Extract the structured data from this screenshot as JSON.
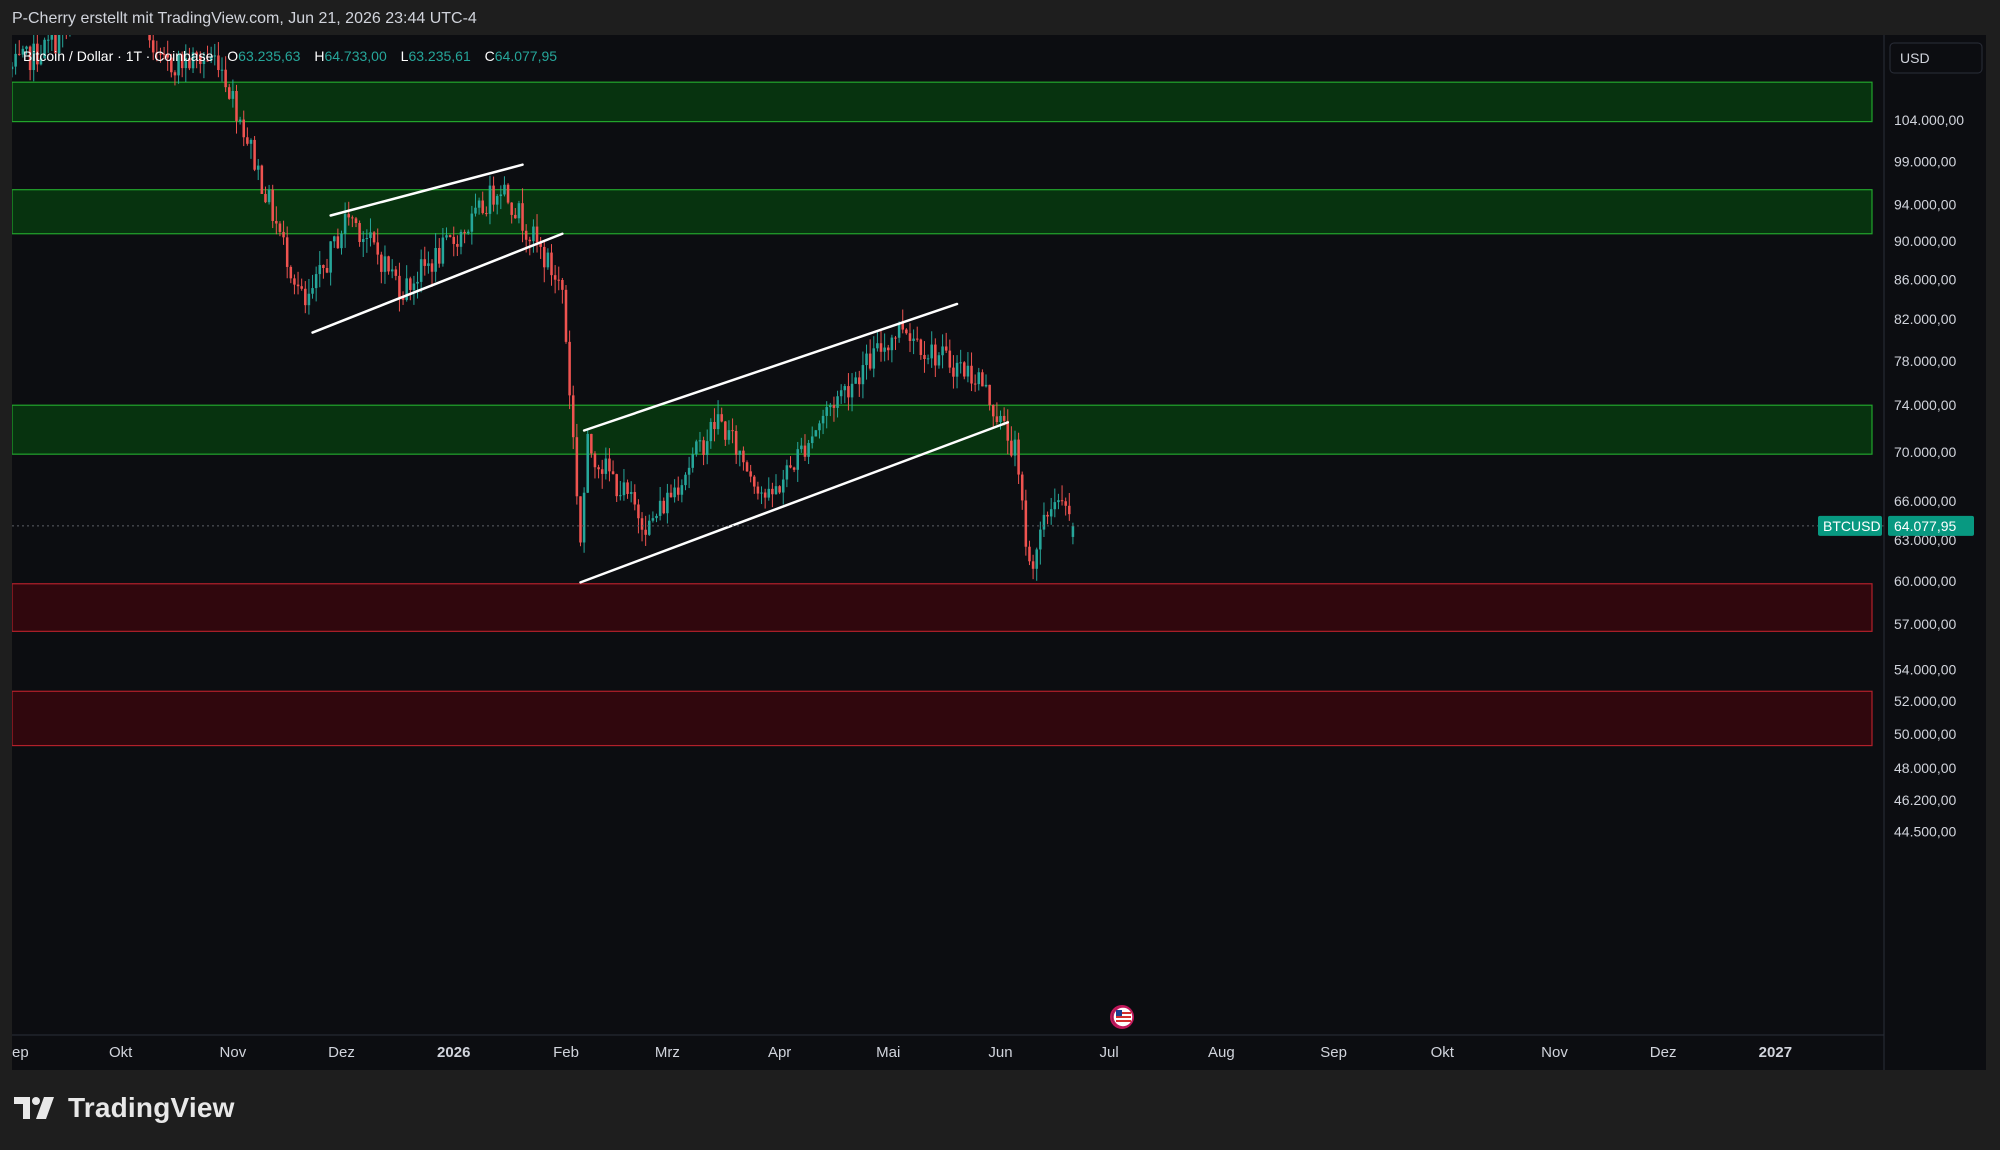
{
  "header": {
    "attribution": "P-Cherry erstellt mit TradingView.com, Jun 21, 2026 23:44 UTC-4"
  },
  "legend": {
    "symbol": "Bitcoin / Dollar · 1T · Coinbase",
    "open_label": "O",
    "open_value": "63.235,63",
    "high_label": "H",
    "high_value": "64.733,00",
    "low_label": "L",
    "low_value": "63.235,61",
    "close_label": "C",
    "close_value": "64.077,95"
  },
  "currency_label": "USD",
  "price_tag": {
    "symbol": "BTCUSD",
    "value": "64.077,95"
  },
  "footer": {
    "brand": "TradingView"
  },
  "colors": {
    "up": "#26a69a",
    "down": "#ef5350",
    "support_zone": "#07330f",
    "support_border": "#22a52c",
    "resistance_zone": "#30070d",
    "resistance_border": "#b3202a",
    "price_tag": "#089981"
  },
  "chart_data": {
    "type": "candlestick",
    "title": "Bitcoin / Dollar · 1T · Coinbase",
    "ylim": [
      44000,
      110000
    ],
    "y_scale": "log",
    "y_ticks": [
      {
        "value": 104000,
        "label": "104.000,00"
      },
      {
        "value": 99000,
        "label": "99.000,00"
      },
      {
        "value": 94000,
        "label": "94.000,00"
      },
      {
        "value": 90000,
        "label": "90.000,00"
      },
      {
        "value": 86000,
        "label": "86.000,00"
      },
      {
        "value": 82000,
        "label": "82.000,00"
      },
      {
        "value": 78000,
        "label": "78.000,00"
      },
      {
        "value": 74000,
        "label": "74.000,00"
      },
      {
        "value": 70000,
        "label": "70.000,00"
      },
      {
        "value": 66000,
        "label": "66.000,00"
      },
      {
        "value": 63000,
        "label": "63.000,00"
      },
      {
        "value": 60000,
        "label": "60.000,00"
      },
      {
        "value": 57000,
        "label": "57.000,00"
      },
      {
        "value": 54000,
        "label": "54.000,00"
      },
      {
        "value": 52000,
        "label": "52.000,00"
      },
      {
        "value": 50000,
        "label": "50.000,00"
      },
      {
        "value": 48000,
        "label": "48.000,00"
      },
      {
        "value": 46200,
        "label": "46.200,00"
      },
      {
        "value": 44500,
        "label": "44.500,00"
      }
    ],
    "x_range": [
      "2025-09-01",
      "2027-01-31"
    ],
    "x_ticks": [
      {
        "date": "2025-09-01",
        "label": "ep"
      },
      {
        "date": "2025-10-01",
        "label": "Okt"
      },
      {
        "date": "2025-11-01",
        "label": "Nov"
      },
      {
        "date": "2025-12-01",
        "label": "Dez"
      },
      {
        "date": "2026-01-01",
        "label": "2026",
        "bold": true
      },
      {
        "date": "2026-02-01",
        "label": "Feb"
      },
      {
        "date": "2026-03-01",
        "label": "Mrz"
      },
      {
        "date": "2026-04-01",
        "label": "Apr"
      },
      {
        "date": "2026-05-01",
        "label": "Mai"
      },
      {
        "date": "2026-06-01",
        "label": "Jun"
      },
      {
        "date": "2026-07-01",
        "label": "Jul"
      },
      {
        "date": "2026-08-01",
        "label": "Aug"
      },
      {
        "date": "2026-09-01",
        "label": "Sep"
      },
      {
        "date": "2026-10-01",
        "label": "Okt"
      },
      {
        "date": "2026-11-01",
        "label": "Nov"
      },
      {
        "date": "2026-12-01",
        "label": "Dez"
      },
      {
        "date": "2027-01-01",
        "label": "2027",
        "bold": true
      }
    ],
    "last_price": 64077.95,
    "zones": [
      {
        "kind": "support",
        "low": 103800,
        "high": 108800
      },
      {
        "kind": "support",
        "low": 90800,
        "high": 95700
      },
      {
        "kind": "support",
        "low": 69800,
        "high": 74000
      },
      {
        "kind": "resistance",
        "low": 56500,
        "high": 59800
      },
      {
        "kind": "resistance",
        "low": 49300,
        "high": 52600
      }
    ],
    "trendlines": [
      {
        "from": {
          "date": "2025-11-28",
          "price": 92800
        },
        "to": {
          "date": "2026-01-20",
          "price": 98600
        }
      },
      {
        "from": {
          "date": "2025-11-23",
          "price": 80700
        },
        "to": {
          "date": "2026-01-31",
          "price": 90800
        }
      },
      {
        "from": {
          "date": "2026-02-06",
          "price": 71800
        },
        "to": {
          "date": "2026-05-20",
          "price": 83500
        }
      },
      {
        "from": {
          "date": "2026-02-05",
          "price": 59900
        },
        "to": {
          "date": "2026-06-03",
          "price": 72500
        }
      }
    ],
    "path_anchors": [
      {
        "date": "2025-09-01",
        "price": 110500
      },
      {
        "date": "2025-10-06",
        "price": 122000
      },
      {
        "date": "2025-10-11",
        "price": 111000
      },
      {
        "date": "2025-10-28",
        "price": 112000
      },
      {
        "date": "2025-11-04",
        "price": 103000
      },
      {
        "date": "2025-11-21",
        "price": 83000
      },
      {
        "date": "2025-12-03",
        "price": 93000
      },
      {
        "date": "2025-12-18",
        "price": 85000
      },
      {
        "date": "2026-01-06",
        "price": 92000
      },
      {
        "date": "2026-01-14",
        "price": 96500
      },
      {
        "date": "2026-01-31",
        "price": 85000
      },
      {
        "date": "2026-02-05",
        "price": 63000
      },
      {
        "date": "2026-02-07",
        "price": 70500
      },
      {
        "date": "2026-02-24",
        "price": 64000
      },
      {
        "date": "2026-03-15",
        "price": 72800
      },
      {
        "date": "2026-03-29",
        "price": 66000
      },
      {
        "date": "2026-04-15",
        "price": 74000
      },
      {
        "date": "2026-05-05",
        "price": 81500
      },
      {
        "date": "2026-05-12",
        "price": 79000
      },
      {
        "date": "2026-05-26",
        "price": 76500
      },
      {
        "date": "2026-06-05",
        "price": 70000
      },
      {
        "date": "2026-06-09",
        "price": 61000
      },
      {
        "date": "2026-06-16",
        "price": 66500
      },
      {
        "date": "2026-06-21",
        "price": 64077.95
      }
    ]
  }
}
